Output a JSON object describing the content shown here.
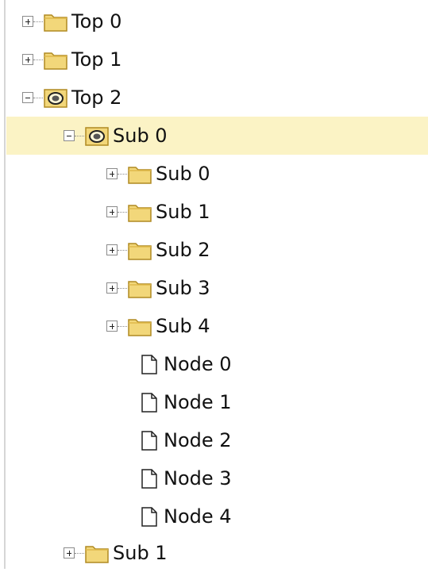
{
  "tree": {
    "rows": [
      {
        "label": "Top 0",
        "type": "folder",
        "expander": "plus",
        "level": 0
      },
      {
        "label": "Top 1",
        "type": "folder",
        "expander": "plus",
        "level": 0
      },
      {
        "label": "Top 2",
        "type": "folder-open",
        "expander": "minus",
        "level": 0
      },
      {
        "label": "Sub 0",
        "type": "folder-open",
        "expander": "minus",
        "level": 1,
        "selected": true
      },
      {
        "label": "Sub 0",
        "type": "folder",
        "expander": "plus",
        "level": 2
      },
      {
        "label": "Sub 1",
        "type": "folder",
        "expander": "plus",
        "level": 2
      },
      {
        "label": "Sub 2",
        "type": "folder",
        "expander": "plus",
        "level": 2
      },
      {
        "label": "Sub 3",
        "type": "folder",
        "expander": "plus",
        "level": 2
      },
      {
        "label": "Sub 4",
        "type": "folder",
        "expander": "plus",
        "level": 2
      },
      {
        "label": "Node 0",
        "type": "page",
        "level": 2
      },
      {
        "label": "Node 1",
        "type": "page",
        "level": 2
      },
      {
        "label": "Node 2",
        "type": "page",
        "level": 2
      },
      {
        "label": "Node 3",
        "type": "page",
        "level": 2
      },
      {
        "label": "Node 4",
        "type": "page",
        "level": 2
      },
      {
        "label": "Sub 1",
        "type": "folder",
        "expander": "plus",
        "level": 1
      }
    ]
  },
  "colors": {
    "selection": "#fbf3c5",
    "folder": "#f2d77a",
    "folder_outline": "#b08a22"
  },
  "icons": {
    "folder": "folder-icon",
    "folder_open": "folder-open-icon",
    "page": "page-icon",
    "expand": "plus-expander-icon",
    "collapse": "minus-expander-icon"
  }
}
